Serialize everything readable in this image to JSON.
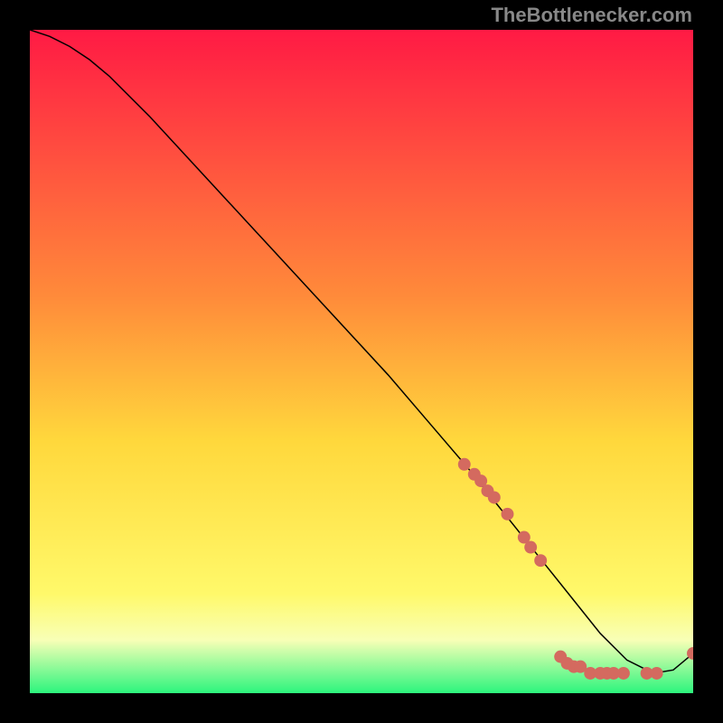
{
  "watermark": "TheBottlenecker.com",
  "chart_data": {
    "type": "line",
    "title": "",
    "xlabel": "",
    "ylabel": "",
    "xlim": [
      0,
      100
    ],
    "ylim": [
      0,
      100
    ],
    "gradient": {
      "top": "#ff1a44",
      "mid_upper": "#ff8a3a",
      "mid": "#ffd83c",
      "mid_lower": "#fff96a",
      "bottom": "#2cf57d"
    },
    "line": {
      "color": "#000000",
      "x": [
        0,
        3,
        6,
        9,
        12,
        18,
        24,
        30,
        36,
        42,
        48,
        54,
        60,
        66,
        70,
        74,
        78,
        82,
        86,
        90,
        94,
        97,
        100
      ],
      "y": [
        100,
        99,
        97.5,
        95.5,
        93,
        87,
        80.5,
        74,
        67.5,
        61,
        54.5,
        48,
        41,
        34,
        29,
        24,
        19,
        14,
        9,
        5,
        3,
        3.5,
        6
      ]
    },
    "scatter": {
      "color": "#d46a5f",
      "radius": 7,
      "points": [
        {
          "x": 65.5,
          "y": 34.5
        },
        {
          "x": 67,
          "y": 33
        },
        {
          "x": 68,
          "y": 32
        },
        {
          "x": 69,
          "y": 30.5
        },
        {
          "x": 70,
          "y": 29.5
        },
        {
          "x": 72,
          "y": 27
        },
        {
          "x": 74.5,
          "y": 23.5
        },
        {
          "x": 75.5,
          "y": 22
        },
        {
          "x": 77,
          "y": 20
        },
        {
          "x": 80,
          "y": 5.5
        },
        {
          "x": 81,
          "y": 4.5
        },
        {
          "x": 82,
          "y": 4
        },
        {
          "x": 83,
          "y": 4
        },
        {
          "x": 84.5,
          "y": 3
        },
        {
          "x": 86,
          "y": 3
        },
        {
          "x": 87,
          "y": 3
        },
        {
          "x": 88,
          "y": 3
        },
        {
          "x": 89.5,
          "y": 3
        },
        {
          "x": 93,
          "y": 3
        },
        {
          "x": 94.5,
          "y": 3
        },
        {
          "x": 100,
          "y": 6
        }
      ]
    }
  }
}
